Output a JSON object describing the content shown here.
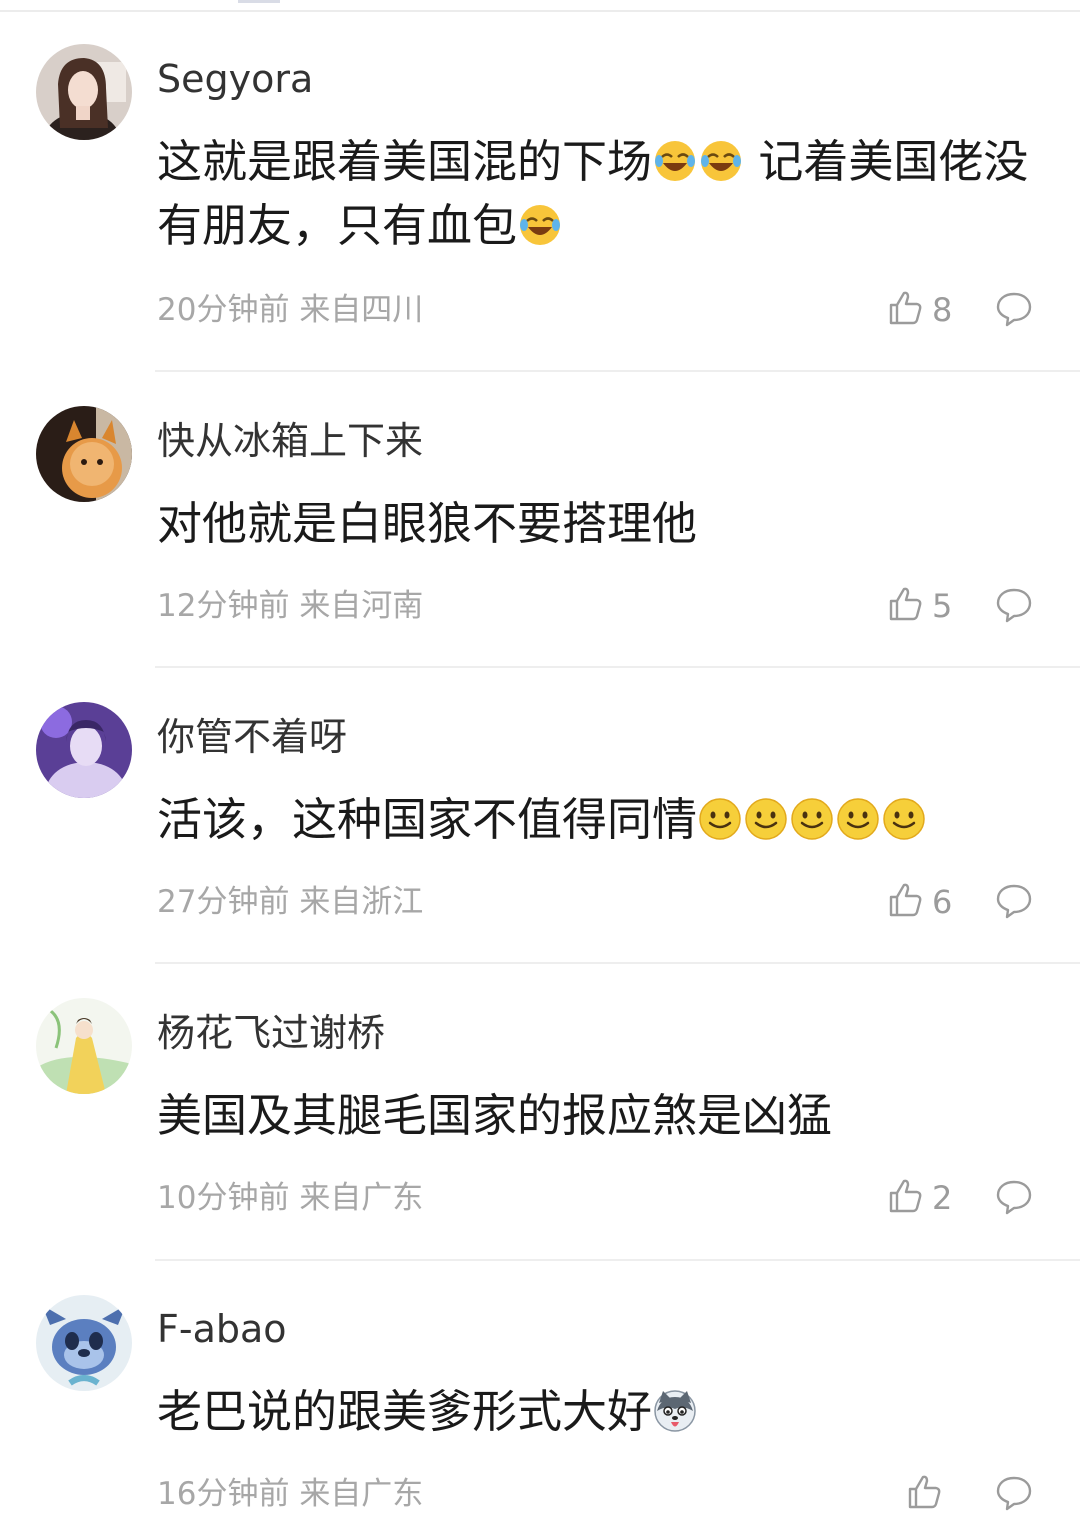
{
  "comments": [
    {
      "username": "Segyora",
      "text_part1": "这就是跟着美国混的下场",
      "text_part2": " 记着美国佬没有朋友，只有血包",
      "emoji_after_part1": [
        "laughing-tears-emoji",
        "laughing-tears-emoji"
      ],
      "emoji_after_part2": [
        "laughing-tears-emoji"
      ],
      "time": "20分钟前",
      "location": "来自四川",
      "likes": "8"
    },
    {
      "username": "快从冰箱上下来",
      "text": "对他就是白眼狼不要搭理他",
      "time": "12分钟前",
      "location": "来自河南",
      "likes": "5"
    },
    {
      "username": "你管不着呀",
      "text": "活该，这种国家不值得同情",
      "emoji_after": [
        "smile-emoji",
        "smile-emoji",
        "smile-emoji",
        "smile-emoji",
        "smile-emoji"
      ],
      "time": "27分钟前",
      "location": "来自浙江",
      "likes": "6"
    },
    {
      "username": "杨花飞过谢桥",
      "text": "美国及其腿毛国家的报应煞是凶猛",
      "time": "10分钟前",
      "location": "来自广东",
      "likes": "2"
    },
    {
      "username": "F-abao",
      "text": "老巴说的跟美爹形式大好",
      "emoji_after": [
        "husky-dog-emoji"
      ],
      "time": "16分钟前",
      "location": "来自广东",
      "likes": ""
    }
  ],
  "icons": {
    "like": "thumbs-up-icon",
    "reply": "comment-bubble-icon"
  },
  "colors": {
    "text": "#1a1a1a",
    "username": "#333333",
    "meta": "#a7a7a7",
    "divider": "#eeeeee"
  }
}
